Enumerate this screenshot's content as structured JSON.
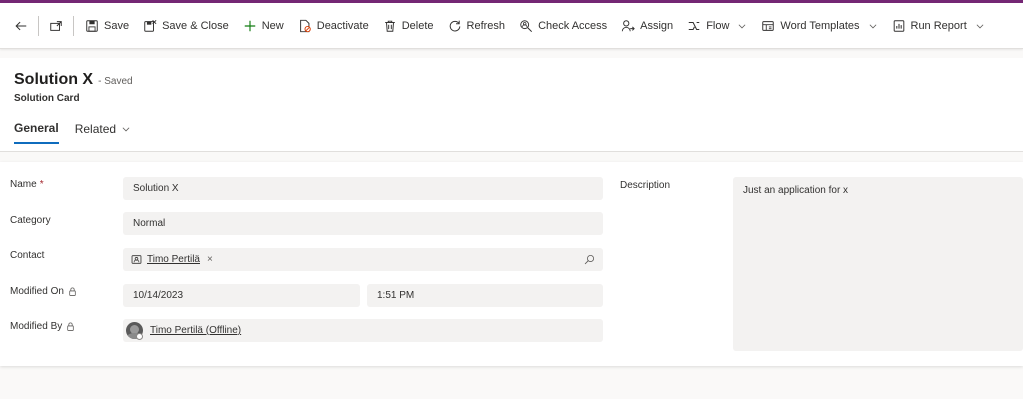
{
  "toolbar": {
    "back_icon": "back-arrow-icon",
    "popout_icon": "popout-icon",
    "save": "Save",
    "save_close": "Save & Close",
    "new": "New",
    "deactivate": "Deactivate",
    "delete": "Delete",
    "refresh": "Refresh",
    "check_access": "Check Access",
    "assign": "Assign",
    "flow": "Flow",
    "word_templates": "Word Templates",
    "run_report": "Run Report"
  },
  "header": {
    "title": "Solution X",
    "status": "- Saved",
    "entity": "Solution Card"
  },
  "tabs": [
    {
      "label": "General",
      "active": true
    },
    {
      "label": "Related",
      "active": false
    }
  ],
  "form": {
    "name_label": "Name",
    "required_marker": "*",
    "name_value": "Solution X",
    "category_label": "Category",
    "category_value": "Normal",
    "contact_label": "Contact",
    "contact_value": "Timo Pertilä",
    "contact_remove": "×",
    "modified_on_label": "Modified On",
    "modified_on_date": "10/14/2023",
    "modified_on_time": "1:51 PM",
    "modified_by_label": "Modified By",
    "modified_by_value": "Timo Pertilä (Offline)",
    "description_label": "Description",
    "description_value": "Just an application for x"
  },
  "colors": {
    "brand_bar": "#742774",
    "accent": "#0f6cbd",
    "required": "#a4262c",
    "field_bg": "#f3f2f1"
  }
}
